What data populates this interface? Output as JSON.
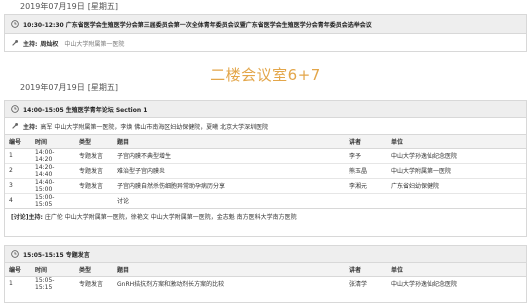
{
  "day1": {
    "date": "2019年07月19日",
    "weekday": "[星期五]"
  },
  "session0": {
    "header": "10:30-12:30  广东省医学会生殖医学分会第三届委员会第一次全体青年委员会议暨广东省医学会生殖医学分会青年委员会选举会议",
    "host_label": "主持:",
    "host_name": "周灿权",
    "host_org": "中山大学附属第一医院"
  },
  "room_title": "二楼会议室6+7",
  "day2": {
    "date": "2019年07月19日",
    "weekday": "[星期五]"
  },
  "section1": {
    "header": "14:00-15:05  生殖医学青年论坛 Section 1",
    "host_label": "主持:",
    "hosts": "高军  中山大学附属第一医院，李焕  佛山市南海区妇幼保健院，夏曦  北京大学深圳医院",
    "columns": [
      "编号",
      "时间",
      "类型",
      "题目",
      "讲者",
      "单位"
    ],
    "rows": [
      [
        "1",
        "14:00-14:20",
        "专题发言",
        "子宫内膜不典型增生",
        "李予",
        "中山大学孙逸仙纪念医院"
      ],
      [
        "2",
        "14:20-14:40",
        "专题发言",
        "难治型子宫内膜炎",
        "熊玉晶",
        "中山大学附属第一医院"
      ],
      [
        "3",
        "14:40-15:00",
        "专题发言",
        "子宫内膜自然杀伤细胞异常助孕病历分享",
        "李湘元",
        "广东省妇幼保健院"
      ],
      [
        "4",
        "15:00-15:05",
        "",
        "讨论",
        "",
        ""
      ]
    ],
    "discussion_label": "[讨论]主持:",
    "discussion_hosts": "庄广伦  中山大学附属第一医院，徐艳文  中山大学附属第一医院，金志魁  南方医科大学南方医院"
  },
  "section2": {
    "header": "15:05-15:15  专题发言",
    "columns": [
      "编号",
      "时间",
      "类型",
      "题目",
      "讲者",
      "单位"
    ],
    "rows": [
      [
        "1",
        "15:05-15:15",
        "专题发言",
        "GnRH拮抗剂方案和激动剂长方案的比较",
        "张清学",
        "中山大学孙逸仙纪念医院"
      ]
    ]
  },
  "icons": {
    "clock": "clock-icon",
    "host": "host-icon"
  },
  "colors": {
    "room_title": "#e3a64a",
    "panel_header": "#eeeeee",
    "border": "#d8d8d8"
  }
}
